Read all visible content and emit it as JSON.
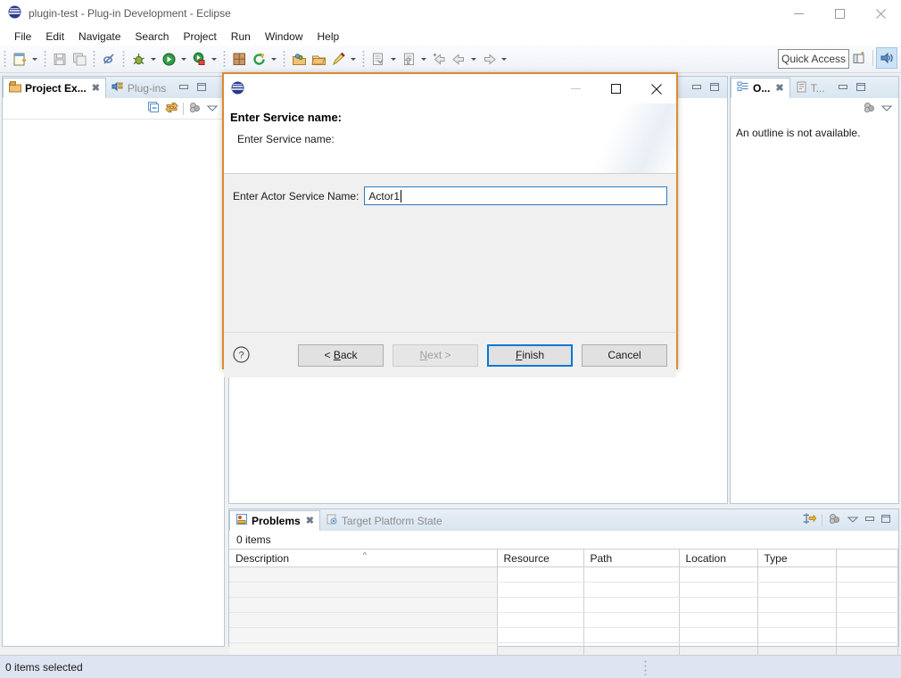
{
  "window": {
    "title": "plugin-test - Plug-in Development - Eclipse",
    "icon": "eclipse-sphere-icon",
    "controls": {
      "minimize": "minimize-icon",
      "maximize": "maximize-icon",
      "close": "close-icon"
    }
  },
  "menubar": {
    "items": [
      "File",
      "Edit",
      "Navigate",
      "Search",
      "Project",
      "Run",
      "Window",
      "Help"
    ]
  },
  "toolbar": {
    "quick_access_placeholder": "Quick Access",
    "buttons": [
      "new-wizard-icon",
      "save-icon",
      "save-all-icon",
      "toggle-breakpoint-icon",
      "debug-icon",
      "run-icon",
      "run-last-icon",
      "new-plugin-project-icon",
      "refresh-icon",
      "open-type-icon",
      "open-task-icon",
      "external-tools-icon",
      "new-java-class-icon",
      "new-java-package-icon",
      "previous-annotation-icon",
      "back-icon",
      "forward-icon"
    ],
    "perspective_buttons": [
      "open-perspective-icon",
      "plugin-development-perspective-icon"
    ]
  },
  "left_panel": {
    "tabs": [
      {
        "label": "Project Ex...",
        "icon": "project-explorer-icon",
        "active": true,
        "closable": true
      },
      {
        "label": "Plug-ins",
        "icon": "plugins-icon",
        "active": false,
        "closable": false
      }
    ],
    "tools": [
      "collapse-all-icon",
      "link-with-editor-icon",
      "view-menu-icon",
      "chevron-down-icon"
    ],
    "min_max": [
      "minimize-view-icon",
      "maximize-view-icon"
    ]
  },
  "editor_area": {
    "min_max": [
      "minimize-view-icon",
      "maximize-view-icon"
    ]
  },
  "right_panel": {
    "tabs": [
      {
        "label": "O...",
        "icon": "outline-icon",
        "active": true,
        "closable": true
      },
      {
        "label": "T...",
        "icon": "task-list-icon",
        "active": false,
        "closable": false
      }
    ],
    "tools": [
      "view-menu-icon",
      "chevron-down-icon"
    ],
    "min_max": [
      "minimize-view-icon",
      "maximize-view-icon"
    ],
    "content": "An outline is not available."
  },
  "problems_panel": {
    "tabs": [
      {
        "label": "Problems",
        "icon": "problems-icon",
        "active": true,
        "closable": true
      },
      {
        "label": "Target Platform State",
        "icon": "target-platform-icon",
        "active": false,
        "closable": false
      }
    ],
    "tools": [
      "filters-icon",
      "view-menu-icon",
      "chevron-down-icon"
    ],
    "min_max": [
      "minimize-view-icon",
      "maximize-view-icon"
    ],
    "items_count": "0 items",
    "columns": [
      "Description",
      "Resource",
      "Path",
      "Location",
      "Type"
    ],
    "sort_column": "Description",
    "sort_indicator": "^",
    "rows": []
  },
  "statusbar": {
    "text": "0 items selected"
  },
  "dialog": {
    "icon": "eclipse-sphere-icon",
    "controls": {
      "minimize": "minimize-icon",
      "maximize": "maximize-icon",
      "close": "close-icon"
    },
    "title": "Enter Service name:",
    "subtitle": "Enter Service name:",
    "field": {
      "label": "Enter Actor Service Name:",
      "value": "Actor1"
    },
    "help_icon": "help-question-icon",
    "buttons": [
      {
        "label": "< Back",
        "mnemonic": "B",
        "state": "enabled"
      },
      {
        "label": "Next >",
        "mnemonic": "N",
        "state": "disabled"
      },
      {
        "label": "Finish",
        "mnemonic": "F",
        "state": "default"
      },
      {
        "label": "Cancel",
        "mnemonic": "",
        "state": "enabled"
      }
    ],
    "border_color": "#e08a2e"
  }
}
